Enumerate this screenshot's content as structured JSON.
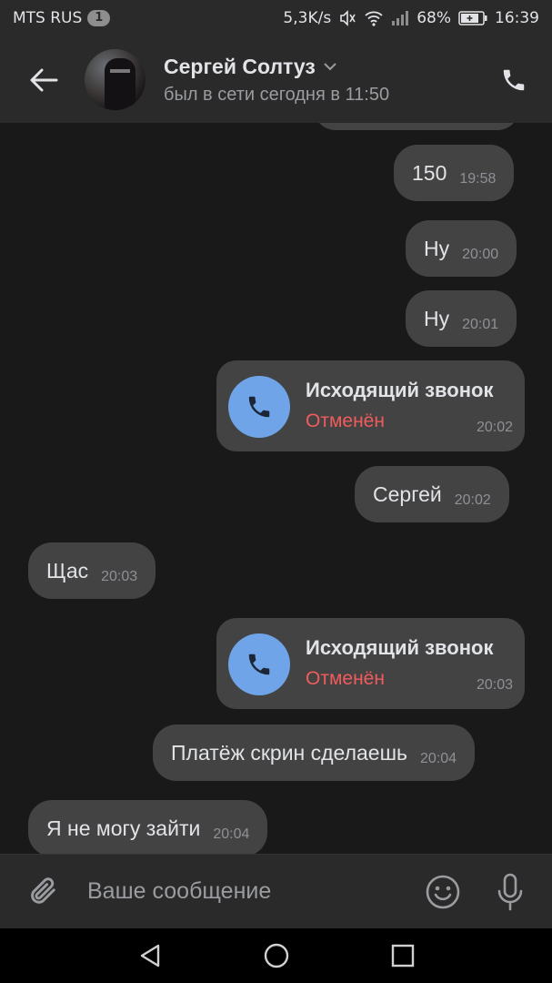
{
  "status_bar": {
    "carrier": "MTS RUS",
    "notification_count": "1",
    "network_speed": "5,3K/s",
    "battery_percent": "68%",
    "time": "16:39"
  },
  "header": {
    "contact_name": "Сергей Солтуз",
    "last_seen": "был в сети сегодня в 11:50"
  },
  "messages": [
    {
      "text": "150",
      "time": "19:58"
    },
    {
      "text": "Ну",
      "time": "20:00"
    },
    {
      "text": "Ну",
      "time": "20:01"
    },
    {
      "title": "Исходящий звонок",
      "status": "Отменён",
      "time": "20:02"
    },
    {
      "text": "Сергей",
      "time": "20:02"
    },
    {
      "text": "Щас",
      "time": "20:03"
    },
    {
      "title": "Исходящий звонок",
      "status": "Отменён",
      "time": "20:03"
    },
    {
      "text": "Платёж скрин сделаешь",
      "time": "20:04"
    },
    {
      "text": "Я не могу зайти",
      "time": "20:04"
    }
  ],
  "composer": {
    "placeholder": "Ваше сообщение"
  },
  "colors": {
    "background": "#19191a",
    "bar": "#2a2a2b",
    "bubble": "#434344",
    "call_icon": "#6fa5e8",
    "call_cancelled": "#f05c5c"
  }
}
